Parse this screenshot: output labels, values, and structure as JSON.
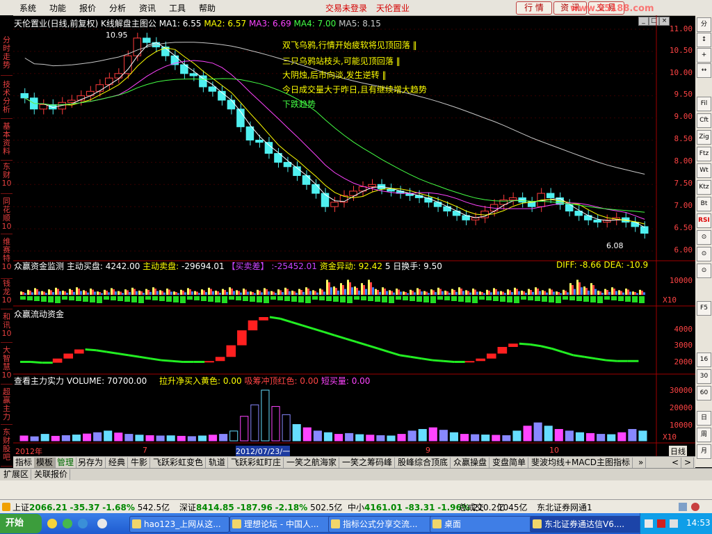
{
  "menubar": {
    "items": [
      "系统",
      "功能",
      "报价",
      "分析",
      "资讯",
      "工具",
      "帮助"
    ],
    "status_login": "交易未登录",
    "status_name": "天伦置业",
    "buttons": [
      "行 情",
      "资 讯",
      "交 易"
    ],
    "watermark": "www.55188.com"
  },
  "left_tabs": [
    "分时走势",
    "技术分析",
    "基本资料",
    "东财10",
    "同花顺10",
    "维赛特10",
    "钱龙10",
    "和讯10",
    "大智慧10",
    "超赢主力",
    "东财股吧"
  ],
  "right_buttons": [
    "分",
    "↕",
    "+",
    "↔",
    "Fil",
    "Cft",
    "Zig",
    "Ftz",
    "Wt",
    "Ktz",
    "Bt",
    "RSI",
    "⊙",
    "⊙",
    "⊙",
    "F5",
    "16",
    "30",
    "60",
    "日",
    "周",
    "月"
  ],
  "main_chart": {
    "title_main": "天伦置业(日线,前复权)",
    "title_formula": "K线解盘主图公",
    "ma_labels": [
      "MA1: 6.55",
      "MA2: 6.57",
      "MA3: 6.69",
      "MA4: 7.00",
      "MA5: 8.15"
    ],
    "ma_colors": [
      "#ffffff",
      "#ffff00",
      "#ff44ff",
      "#44ff44",
      "#c8c8c8"
    ],
    "high_marker": "10.95",
    "low_marker": "6.08",
    "annotations": [
      "双飞乌鸦,行情开始疲软将见顶回落 ‖",
      "三只乌鸦站枝头,可能见顶回落 ‖",
      "大阴烛,后市向淡,发生逆转 ‖",
      "今日成交量大于昨日,且有继续增大趋势",
      "下跌趋势"
    ],
    "annotation_colors": [
      "#ffff00",
      "#ffff00",
      "#ffff00",
      "#ffff00",
      "#44ff44"
    ],
    "y_ticks": [
      "11.00",
      "10.50",
      "10.00",
      "9.50",
      "9.00",
      "8.50",
      "8.00",
      "7.50",
      "7.00",
      "6.50",
      "6.00"
    ]
  },
  "chart_data": [
    {
      "type": "candlestick",
      "title": "天伦置业(日线,前复权)",
      "ylim": [
        6.0,
        11.0
      ],
      "y_ticks": [
        6.0,
        6.5,
        7.0,
        7.5,
        8.0,
        8.5,
        9.0,
        9.5,
        10.0,
        10.5,
        11.0
      ],
      "x_labels": [
        "2012年",
        "7",
        "2012/07/23/一",
        "9",
        "10"
      ],
      "high": 10.95,
      "low": 6.08,
      "close": [
        9.45,
        9.2,
        9.3,
        9.2,
        9.35,
        9.4,
        9.5,
        9.6,
        9.75,
        9.9,
        10.0,
        10.4,
        10.8,
        10.7,
        10.6,
        10.4,
        10.2,
        10.0,
        9.95,
        9.7,
        9.6,
        9.4,
        9.2,
        8.8,
        8.5,
        8.45,
        8.2,
        8.0,
        7.9,
        7.7,
        7.5,
        7.3,
        7.0,
        7.1,
        7.25,
        7.35,
        7.45,
        7.5,
        7.4,
        7.35,
        7.3,
        7.25,
        7.2,
        7.1,
        7.0,
        6.9,
        6.8,
        6.7,
        6.75,
        6.9,
        7.05,
        7.15,
        7.2,
        7.1,
        7.0,
        7.3,
        7.2,
        7.05,
        6.9,
        6.8,
        6.7,
        6.65,
        6.7,
        6.75,
        6.65,
        6.55,
        6.4
      ],
      "series": [
        {
          "name": "MA1",
          "last": 6.55
        },
        {
          "name": "MA2",
          "last": 6.57
        },
        {
          "name": "MA3",
          "last": 6.69
        },
        {
          "name": "MA4",
          "last": 7.0
        },
        {
          "name": "MA5",
          "last": 8.15
        }
      ]
    },
    {
      "type": "bar",
      "title": "众赢资金监测",
      "y_ticks": [
        10000
      ],
      "multiplier": "X10"
    },
    {
      "type": "line",
      "title": "众赢流动资金",
      "ylim": [
        1500,
        4600
      ],
      "y_ticks": [
        2000,
        3000,
        4000
      ],
      "values": [
        1900,
        1900,
        1850,
        1850,
        2100,
        2400,
        2650,
        2600,
        2500,
        2400,
        2300,
        2200,
        2100,
        2000,
        1950,
        1900,
        1900,
        1900,
        1950,
        2200,
        2900,
        3800,
        4400,
        4600,
        4500,
        4300,
        4100,
        3900,
        3700,
        3500,
        3300,
        3100,
        2900,
        2700,
        2500,
        2300,
        2200,
        2100,
        2000,
        1950,
        1900,
        1900,
        1950,
        2100,
        2400,
        2800,
        3000,
        2950,
        2850,
        2700,
        2500,
        2300,
        2200,
        2100,
        2000,
        1950,
        1950,
        1950
      ]
    },
    {
      "type": "bar",
      "title": "查看主力实力",
      "y_ticks": [
        10000,
        20000,
        30000
      ],
      "multiplier": "X10",
      "values": [
        3000,
        2500,
        4000,
        2800,
        3200,
        3600,
        4200,
        5000,
        6000,
        4800,
        4000,
        3500,
        3200,
        3000,
        3100,
        2800,
        2600,
        3000,
        3500,
        4000,
        6000,
        15000,
        22000,
        31000,
        21000,
        16000,
        10000,
        8000,
        6000,
        5000,
        4000,
        4500,
        3800,
        3500,
        3200,
        3000,
        4000,
        6000,
        7000,
        8000,
        6500,
        5000,
        4000,
        3800,
        3600,
        3400,
        3200,
        6000,
        9000,
        11000,
        9000,
        7000,
        6000,
        5000,
        4500,
        4000,
        3800,
        5000,
        7000,
        6000
      ]
    }
  ],
  "panel1": {
    "title": "众赢资金监测",
    "buy_label": "主动买盘:",
    "buy_value": "4242.00",
    "sell_label": "主动卖盘:",
    "sell_value": "-29694.01",
    "diff_label": "【买卖差】",
    "diff_value": ":-25452.01",
    "abnormal_label": "资金异动:",
    "abnormal_value": "92.42",
    "turnover": "5 日换手: 9.50",
    "diff_indicator": "DIFF: -8.66",
    "dea_indicator": "DEA: -10.9",
    "y_tick": "10000",
    "multiplier": "X10"
  },
  "panel2": {
    "title": "众赢流动资金",
    "y_ticks": [
      "4000",
      "3000",
      "2000"
    ]
  },
  "panel3": {
    "title": "查看主力实力",
    "volume": "VOLUME: 70700.00",
    "yellow_label": "拉升净买入黄色: 0.00",
    "red_label": "吸筹冲顶红色: 0.00",
    "short_label": "短买量: 0.00",
    "y_ticks": [
      "30000",
      "20000",
      "10000"
    ],
    "multiplier": "X10"
  },
  "x_axis": {
    "labels": [
      "2012年",
      "7",
      "2012/07/23/一",
      "9",
      "10"
    ],
    "right_label": "日线"
  },
  "formula_tabs": [
    "指标",
    "模板",
    "管理",
    "另存为",
    "经典",
    "牛影",
    "飞跃彩虹变色",
    "轨道",
    "飞跃彩虹盯庄",
    "一笑之航海家",
    "一笑之筹码峰",
    "股峰综合顶底",
    "众赢操盘",
    "变盘简单",
    "斐波均线+MACD主图指标"
  ],
  "ext_tabs": [
    "扩展区",
    "关联报价"
  ],
  "statusbar": {
    "sh_label": "上证",
    "sh_value": "2066.21",
    "sh_change": "-35.37",
    "sh_pct": "-1.68%",
    "sh_amount": "542.5亿",
    "sz_label": "深证",
    "sz_value": "8414.85",
    "sz_change": "-187.96",
    "sz_pct": "-2.18%",
    "sz_amount": "502.5亿",
    "zx_label": "中小",
    "zx_value": "4161.01",
    "zx_change": "-83.31",
    "zx_pct": "-1.96%",
    "zx_amount": "210.2亿",
    "total_label": "总成交",
    "total_value": "1045亿",
    "network": "东北证券网通1"
  },
  "taskbar": {
    "start": "开始",
    "tasks": [
      "hao123_上网从这...",
      "理想论坛 - 中国人...",
      "指标公式分享交流...",
      "桌面",
      "东北证券通达信V6...."
    ],
    "clock": "14:53"
  }
}
